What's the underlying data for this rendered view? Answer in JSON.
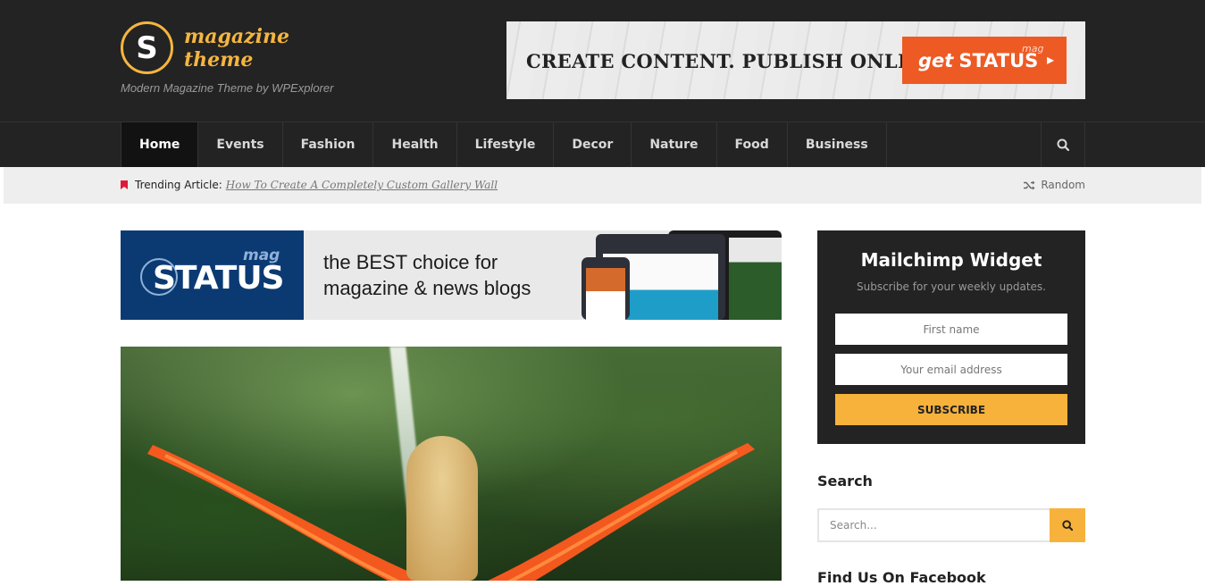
{
  "header": {
    "logo_letter": "S",
    "logo_line1": "magazine",
    "logo_line2": "theme",
    "tagline": "Modern Magazine Theme by WPExplorer",
    "ad_text": "CREATE CONTENT. PUBLISH ONLINE.",
    "ad_button_get": "get",
    "ad_button_brand": "STATUS",
    "ad_button_mag": "mag"
  },
  "nav": {
    "items": [
      "Home",
      "Events",
      "Fashion",
      "Health",
      "Lifestyle",
      "Decor",
      "Nature",
      "Food",
      "Business"
    ],
    "active": "Home"
  },
  "trending": {
    "label": "Trending Article:",
    "article": "How To Create A Completely Custom Gallery Wall",
    "random": "Random"
  },
  "content_ad": {
    "brand": "STATUS",
    "brand_mag": "mag",
    "slogan_line1": "the BEST choice for",
    "slogan_line2": "magazine & news blogs"
  },
  "sidebar": {
    "mailchimp_title": "Mailchimp Widget",
    "mailchimp_subtitle": "Subscribe for your weekly updates.",
    "first_name_placeholder": "First name",
    "email_placeholder": "Your email address",
    "subscribe_label": "SUBSCRIBE",
    "search_title": "Search",
    "search_placeholder": "Search...",
    "facebook_title": "Find Us On Facebook"
  },
  "colors": {
    "accent": "#f7b23b",
    "header_bg": "#232323",
    "trending_marker": "#e0193a",
    "ad_orange": "#ee5a24",
    "ad_navy": "#0b3a73"
  }
}
